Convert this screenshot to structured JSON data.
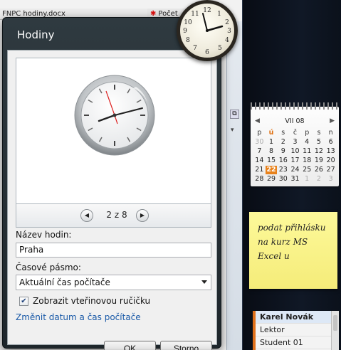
{
  "background": {
    "doc_tab_label": "FNPC hodiny.docx",
    "doc_tab2_label": "Počet"
  },
  "dialog": {
    "title": "Hodiny",
    "pager": {
      "prev_icon": "chevron-left-icon",
      "text": "2 z 8",
      "next_icon": "chevron-right-icon"
    },
    "name_label": "Název hodin:",
    "name_value": "Praha",
    "timezone_label": "Časové pásmo:",
    "timezone_value": "Aktuální čas počítače",
    "seconds_checkbox_label": "Zobrazit vteřinovou ručičku",
    "seconds_checked": true,
    "change_datetime_link": "Změnit datum a čas počítače",
    "ok_label": "OK",
    "cancel_label": "Storno"
  },
  "calendar": {
    "title": "VII 08",
    "prev": "◀",
    "next": "▶",
    "day_names": [
      "p",
      "ú",
      "s",
      "č",
      "p",
      "s",
      "n"
    ],
    "today": "22",
    "days": [
      [
        "30",
        "1",
        "2",
        "3",
        "4",
        "5",
        "6"
      ],
      [
        "7",
        "8",
        "9",
        "10",
        "11",
        "12",
        "13"
      ],
      [
        "14",
        "15",
        "16",
        "17",
        "18",
        "19",
        "20"
      ],
      [
        "21",
        "22",
        "23",
        "24",
        "25",
        "26",
        "27"
      ],
      [
        "28",
        "29",
        "30",
        "31",
        "1",
        "2",
        "3"
      ]
    ]
  },
  "note": {
    "lines": [
      "podat přihlásku",
      "na kurz MS",
      "Excel u"
    ]
  },
  "contacts": {
    "items": [
      "Karel Novák",
      "Lektor",
      "Student 01"
    ]
  },
  "colors": {
    "dialog_frame": "#2a343a",
    "link": "#1a5aa8",
    "today_highlight": "#e8821c",
    "note_yellow": "#f8f28a",
    "sidebar": "#0b111b"
  }
}
